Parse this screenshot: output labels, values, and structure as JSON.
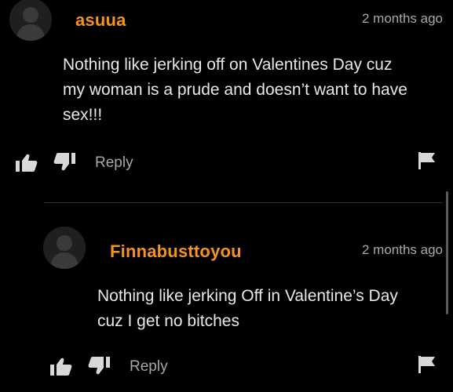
{
  "comments": [
    {
      "username": "asuua",
      "timestamp": "2 months ago",
      "text_lines": [
        "Nothing like jerking off on Valentines Day cuz",
        "my woman is a prude and doesn’t want to have",
        "sex!!!"
      ],
      "reply_label": "Reply"
    },
    {
      "username": "Finnabusttoyou",
      "timestamp": "2 months ago",
      "text_lines": [
        "Nothing like jerking Off in Valentine’s Day",
        "cuz I get no bitches"
      ],
      "reply_label": "Reply"
    }
  ],
  "icons": {
    "avatar": "default-avatar-icon",
    "like": "thumbs-up-icon",
    "dislike": "thumbs-down-icon",
    "flag": "flag-icon"
  },
  "colors": {
    "background": "#000000",
    "username": "#f6921e",
    "text": "#e8e8e8",
    "muted": "#a8a8a8"
  }
}
